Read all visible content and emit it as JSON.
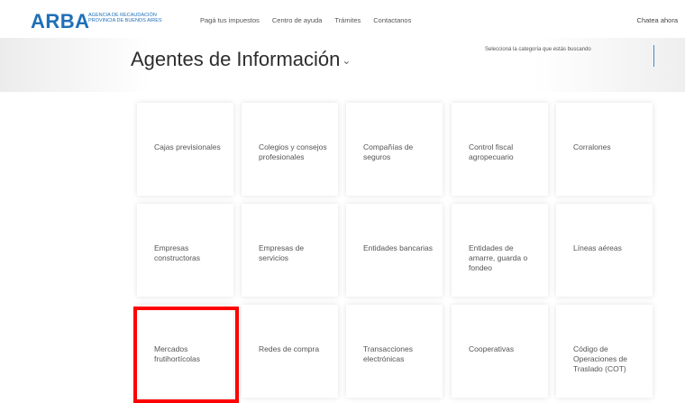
{
  "header": {
    "logo": "ARBA",
    "logo_subtitle": "Agencia de Recaudación Provincia de Buenos Aires",
    "nav": [
      "Pagá tus impuestos",
      "Centro de ayuda",
      "Trámites",
      "Contactanos"
    ],
    "chat": "Chatea ahora"
  },
  "main": {
    "title": "Agentes de Información",
    "category_hint": "Seleccioná la categoría que estás buscando",
    "cards": [
      "Cajas previsionales",
      "Colegios y consejos profesionales",
      "Compañías de seguros",
      "Control fiscal agropecuario",
      "Corralones",
      "Empresas constructoras",
      "Empresas de servicios",
      "Entidades bancarias",
      "Entidades de amarre, guarda o fondeo",
      "Líneas aéreas",
      "Mercados frutihortícolas",
      "Redes de compra",
      "Transacciones electrónicas",
      "Cooperativas",
      "Código de Operaciones de Traslado (COT)"
    ]
  },
  "colors": {
    "brand": "#1e6fb8",
    "highlight": "#ff0000"
  }
}
